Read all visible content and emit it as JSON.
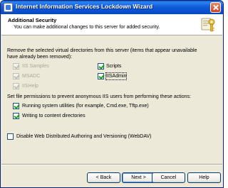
{
  "window": {
    "title": "Internet Information Services Lockdown Wizard"
  },
  "header": {
    "title": "Additional Security",
    "subtitle": "You can make additional changes to this server for added security."
  },
  "section1": {
    "text_line1": "Remove the selected virtual directories from this server (items that appear unavailable",
    "text_line2": "have already been removed):",
    "left_items": [
      {
        "label": "IIS Samples",
        "checked": true,
        "disabled": true
      },
      {
        "label": "MSADC",
        "checked": true,
        "disabled": true
      },
      {
        "label": "IISHelp",
        "checked": true,
        "disabled": true
      }
    ],
    "right_items": [
      {
        "label": "Scripts",
        "checked": true,
        "disabled": false
      },
      {
        "label": "IISAdmin",
        "checked": true,
        "disabled": false
      }
    ]
  },
  "section2": {
    "text": "Set file permissions to prevent anonymous IIS users from performing these actions:",
    "items": [
      {
        "label": "Running system utilities (for example, Cmd.exe, Tftp.exe)",
        "checked": true
      },
      {
        "label": "Writing to content directories",
        "checked": true
      }
    ]
  },
  "section3": {
    "item": {
      "label": "Disable Web Distributed Authoring and Versioning (WebDAV)",
      "checked": false
    }
  },
  "buttons": {
    "back": "< Back",
    "next": "Next >",
    "cancel": "Cancel",
    "help": "Help"
  },
  "colors": {
    "titlebar": "#0a5fd8",
    "dialog_bg": "#ece9d8",
    "check_green": "#21a121"
  },
  "icons": {
    "window": "app-icon",
    "wizard": "wizard-icon",
    "close": "close-icon"
  }
}
